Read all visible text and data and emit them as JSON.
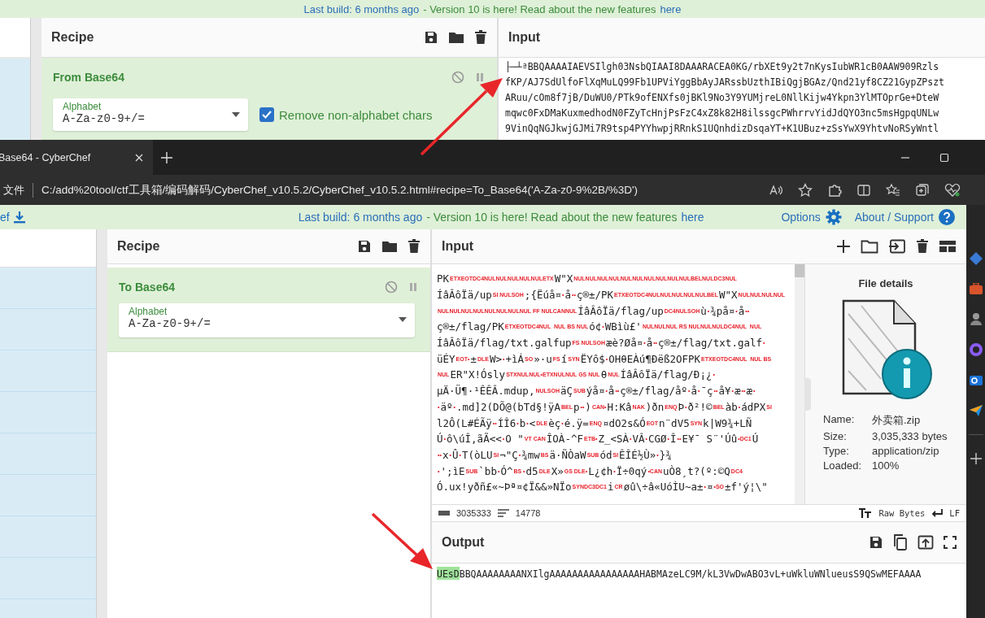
{
  "back_window": {
    "banner": {
      "build": "Last build: 6 months ago",
      "message": "- Version 10 is here! Read about the new features",
      "link": "here"
    },
    "recipe": {
      "title": "Recipe",
      "operation": {
        "name": "From Base64",
        "alphabet_label": "Alphabet",
        "alphabet": "A-Za-z0-9+/=",
        "checkbox": {
          "label": "Remove non-alphabet chars",
          "checked": true
        }
      }
    },
    "input": {
      "title": "Input",
      "lines": [
        "├─┴ªBBQAAAAIAEVSIlgh03NsbQIAAI8DAAARACEA0KG/rbXEt9y2t7nKysIubWR1cB0AAW909Rzls",
        "fKP/AJ7SdUlfoFlXqMuLQ99Fb1UPViYggBbAyJARssbUzthIBiQgjBGAz/Qnd21yf8CZ21GypZPszt",
        "ARuu/cOm8f7jB/DuWU0/PTk9ofENXfs0jBKl9No3Y9YUMjreL0NllKijw4Ykpn3YlMTOprGe+DteW",
        "mqwc0FxDMaKuxmedhodN0FZyTcHnjPsFzC4xZ8k82H8ilssgcPWhrrvYidJdQYO3nc5msHgpqUNLw",
        "9VinQqNGJkwjGJMi7R9tsp4PYYhwpjRRnkS1UQnhdizDsqaYT+K1UBuz+zSsYwX9YhtvNoRSyWntl"
      ]
    }
  },
  "browser": {
    "tab": {
      "title": "Base64 - CyberChef"
    },
    "address": {
      "scheme": "文件",
      "url": "C:/add%20tool/ctf工具箱/编码解码/CyberChef_v10.5.2/CyberChef_v10.5.2.html#recipe=To_Base64('A-Za-z0-9%2B/%3D')"
    }
  },
  "front_window": {
    "brand": "ef",
    "banner": {
      "build": "Last build: 6 months ago",
      "message": "- Version 10 is here! Read about the new features",
      "link": "here"
    },
    "options": "Options",
    "about": "About / Support",
    "recipe": {
      "title": "Recipe",
      "operation": {
        "name": "To Base64",
        "alphabet_label": "Alphabet",
        "alphabet": "A-Za-z0-9+/="
      }
    },
    "input": {
      "title": "Input",
      "lines": [
        [
          {
            "kind": "text",
            "text": "PK"
          },
          {
            "kind": "ctrl",
            "text": "ETXEOTDC4NULNULNULNULNULETX"
          },
          {
            "kind": "text",
            "text": "W\"X"
          },
          {
            "kind": "ctrl",
            "text": "NULNULNULNULNULNULNULNULNULNULBELNULDC3NUL"
          }
        ],
        [
          {
            "kind": "text",
            "text": "ÍâÂôÏä/up"
          },
          {
            "kind": "ctrl",
            "text": "SI NULSOH"
          },
          {
            "kind": "text",
            "text": ";{Ëúå¤"
          },
          {
            "kind": "ctrl",
            "text": "•"
          },
          {
            "kind": "text",
            "text": "å"
          },
          {
            "kind": "ctrl",
            "text": "••"
          },
          {
            "kind": "text",
            "text": "ç®±/PK"
          },
          {
            "kind": "ctrl",
            "text": "ETXEOTDC4NULNULNULNULNULBEL"
          },
          {
            "kind": "text",
            "text": "W\"X"
          },
          {
            "kind": "ctrl",
            "text": "NULNULNULNUL"
          }
        ],
        [
          {
            "kind": "ctrl",
            "text": "NULNULNULNULNULNULNULNUL FF NULCANNUL"
          },
          {
            "kind": "text",
            "text": "ÍâÂôÏä/flag/up"
          },
          {
            "kind": "ctrl",
            "text": "DC4NULSOH"
          },
          {
            "kind": "text",
            "text": "ù"
          },
          {
            "kind": "ctrl",
            "text": "•"
          },
          {
            "kind": "text",
            "text": "¾på¤"
          },
          {
            "kind": "ctrl",
            "text": "•"
          },
          {
            "kind": "text",
            "text": "å"
          },
          {
            "kind": "ctrl",
            "text": "••"
          }
        ],
        [
          {
            "kind": "text",
            "text": "ç®±/flag/PK"
          },
          {
            "kind": "ctrl",
            "text": "ETXEOTDC4NUL  NUL BS NUL"
          },
          {
            "kind": "text",
            "text": "ó¢"
          },
          {
            "kind": "ctrl",
            "text": "•"
          },
          {
            "kind": "text",
            "text": "WBìù£'"
          },
          {
            "kind": "ctrl",
            "text": "NULNULNUL RS NULNULNULDC4NUL  NUL"
          }
        ],
        [
          {
            "kind": "text",
            "text": "ÍâÂôÏä/flag/txt.galfup"
          },
          {
            "kind": "ctrl",
            "text": "FS NULSOH"
          },
          {
            "kind": "text",
            "text": "æè?Øå¤"
          },
          {
            "kind": "ctrl",
            "text": "•"
          },
          {
            "kind": "text",
            "text": "å"
          },
          {
            "kind": "ctrl",
            "text": "••"
          },
          {
            "kind": "text",
            "text": "ç®±/flag/txt.galf"
          },
          {
            "kind": "ctrl",
            "text": "•"
          }
        ],
        [
          {
            "kind": "text",
            "text": "üÉY"
          },
          {
            "kind": "ctrl",
            "text": "EOT•"
          },
          {
            "kind": "text",
            "text": "±"
          },
          {
            "kind": "ctrl",
            "text": "DLE"
          },
          {
            "kind": "text",
            "text": "W>"
          },
          {
            "kind": "ctrl",
            "text": "•"
          },
          {
            "kind": "text",
            "text": "+ìÁ"
          },
          {
            "kind": "ctrl",
            "text": "SO"
          },
          {
            "kind": "text",
            "text": "»·u"
          },
          {
            "kind": "ctrl",
            "text": "FS"
          },
          {
            "kind": "text",
            "text": "í"
          },
          {
            "kind": "ctrl",
            "text": "SYN"
          },
          {
            "kind": "text",
            "text": "ËYô$"
          },
          {
            "kind": "ctrl",
            "text": "•"
          },
          {
            "kind": "text",
            "text": "OHθEÀú¶Ðëß2OFPK"
          },
          {
            "kind": "ctrl",
            "text": "ETXEOTDC4NUL  NUL BS"
          }
        ],
        [
          {
            "kind": "ctrl",
            "text": "NUL"
          },
          {
            "kind": "text",
            "text": "ER\"X!Ósly"
          },
          {
            "kind": "ctrl",
            "text": "STXNULNUL•ETXNULNUL GS NUL"
          },
          {
            "kind": "text",
            "text": "θ"
          },
          {
            "kind": "ctrl",
            "text": "NUL"
          },
          {
            "kind": "text",
            "text": "ÍâÂôÏä/flag/Ð¡¿"
          },
          {
            "kind": "ctrl",
            "text": "•"
          }
        ],
        [
          {
            "kind": "text",
            "text": "µÄ·Ü¶·¹ÊÊÂ.mdup,"
          },
          {
            "kind": "ctrl",
            "text": "NULSOH"
          },
          {
            "kind": "text",
            "text": "äÇ"
          },
          {
            "kind": "ctrl",
            "text": "SUB"
          },
          {
            "kind": "text",
            "text": "ýå¤"
          },
          {
            "kind": "ctrl",
            "text": "•"
          },
          {
            "kind": "text",
            "text": "å"
          },
          {
            "kind": "ctrl",
            "text": "••"
          },
          {
            "kind": "text",
            "text": "ç®±/flag/åº"
          },
          {
            "kind": "ctrl",
            "text": "•"
          },
          {
            "kind": "text",
            "text": "å"
          },
          {
            "kind": "ctrl",
            "text": "•"
          },
          {
            "kind": "text",
            "text": "¯ç"
          },
          {
            "kind": "ctrl",
            "text": "••"
          },
          {
            "kind": "text",
            "text": "å¥"
          },
          {
            "kind": "ctrl",
            "text": "•"
          },
          {
            "kind": "text",
            "text": "æ"
          },
          {
            "kind": "ctrl",
            "text": "••"
          },
          {
            "kind": "text",
            "text": "æ"
          },
          {
            "kind": "ctrl",
            "text": "•"
          }
        ],
        [
          {
            "kind": "ctrl",
            "text": "•"
          },
          {
            "kind": "text",
            "text": "äº"
          },
          {
            "kind": "ctrl",
            "text": "•"
          },
          {
            "kind": "text",
            "text": ".md]2(DÕ@(bTd§!ÿA"
          },
          {
            "kind": "ctrl",
            "text": "BEL"
          },
          {
            "kind": "text",
            "text": "p"
          },
          {
            "kind": "ctrl",
            "text": "••"
          },
          {
            "kind": "text",
            "text": ")"
          },
          {
            "kind": "ctrl",
            "text": "CAN•"
          },
          {
            "kind": "text",
            "text": "H:Kâ"
          },
          {
            "kind": "ctrl",
            "text": "NAK"
          },
          {
            "kind": "text",
            "text": ")ðn"
          },
          {
            "kind": "ctrl",
            "text": "ENQ"
          },
          {
            "kind": "text",
            "text": "Þ"
          },
          {
            "kind": "ctrl",
            "text": "•"
          },
          {
            "kind": "text",
            "text": "ð²!©"
          },
          {
            "kind": "ctrl",
            "text": "BEL"
          },
          {
            "kind": "text",
            "text": "àb"
          },
          {
            "kind": "ctrl",
            "text": "•"
          },
          {
            "kind": "text",
            "text": "ádPX"
          },
          {
            "kind": "ctrl",
            "text": "SI"
          }
        ],
        [
          {
            "kind": "text",
            "text": "l2Ô(L#ÉÃÿ"
          },
          {
            "kind": "ctrl",
            "text": "••"
          },
          {
            "kind": "text",
            "text": "ÍÎ6"
          },
          {
            "kind": "ctrl",
            "text": "•"
          },
          {
            "kind": "text",
            "text": "b"
          },
          {
            "kind": "ctrl",
            "text": "•"
          },
          {
            "kind": "text",
            "text": "<"
          },
          {
            "kind": "ctrl",
            "text": "DLE"
          },
          {
            "kind": "text",
            "text": "èç"
          },
          {
            "kind": "ctrl",
            "text": "•"
          },
          {
            "kind": "text",
            "text": "é.ÿ="
          },
          {
            "kind": "ctrl",
            "text": "ENQ"
          },
          {
            "kind": "text",
            "text": "¤dO2s&Ó"
          },
          {
            "kind": "ctrl",
            "text": "EOT"
          },
          {
            "kind": "text",
            "text": "n¨dV5"
          },
          {
            "kind": "ctrl",
            "text": "SYN"
          },
          {
            "kind": "text",
            "text": "k|W9¾+LÑ"
          }
        ],
        [
          {
            "kind": "text",
            "text": "Ú"
          },
          {
            "kind": "ctrl",
            "text": "•"
          },
          {
            "kind": "text",
            "text": "ô\\úÎ,ãÃ<<"
          },
          {
            "kind": "ctrl",
            "text": "•"
          },
          {
            "kind": "text",
            "text": "O \""
          },
          {
            "kind": "ctrl",
            "text": "VT CAN"
          },
          {
            "kind": "text",
            "text": "ÎOÀ-^F"
          },
          {
            "kind": "ctrl",
            "text": "ETB•"
          },
          {
            "kind": "text",
            "text": "Z_<SÀ"
          },
          {
            "kind": "ctrl",
            "text": "•"
          },
          {
            "kind": "text",
            "text": "VÂ"
          },
          {
            "kind": "ctrl",
            "text": "•"
          },
          {
            "kind": "text",
            "text": "CGØ"
          },
          {
            "kind": "ctrl",
            "text": "•"
          },
          {
            "kind": "text",
            "text": "Î"
          },
          {
            "kind": "ctrl",
            "text": "••"
          },
          {
            "kind": "text",
            "text": "E¥¯ S¨'Úû"
          },
          {
            "kind": "ctrl",
            "text": "•DC1"
          },
          {
            "kind": "text",
            "text": "Ú"
          }
        ],
        [
          {
            "kind": "ctrl",
            "text": "••"
          },
          {
            "kind": "text",
            "text": "x"
          },
          {
            "kind": "ctrl",
            "text": "•"
          },
          {
            "kind": "text",
            "text": "Û"
          },
          {
            "kind": "ctrl",
            "text": "•"
          },
          {
            "kind": "text",
            "text": "T(òLU"
          },
          {
            "kind": "ctrl",
            "text": "SI"
          },
          {
            "kind": "text",
            "text": "¬\"Ç"
          },
          {
            "kind": "ctrl",
            "text": "•"
          },
          {
            "kind": "text",
            "text": "¾mw"
          },
          {
            "kind": "ctrl",
            "text": "BS"
          },
          {
            "kind": "text",
            "text": "ä·ÑÒaW"
          },
          {
            "kind": "ctrl",
            "text": "SUB"
          },
          {
            "kind": "text",
            "text": "ód"
          },
          {
            "kind": "ctrl",
            "text": "SI"
          },
          {
            "kind": "text",
            "text": "ÊÎÉ½Ù»"
          },
          {
            "kind": "ctrl",
            "text": "•"
          },
          {
            "kind": "text",
            "text": "}¾"
          }
        ],
        [
          {
            "kind": "ctrl",
            "text": "•"
          },
          {
            "kind": "text",
            "text": "';ìE"
          },
          {
            "kind": "ctrl",
            "text": "SUB"
          },
          {
            "kind": "text",
            "text": "`bb"
          },
          {
            "kind": "ctrl",
            "text": "•"
          },
          {
            "kind": "text",
            "text": "Ó^"
          },
          {
            "kind": "ctrl",
            "text": "BS •"
          },
          {
            "kind": "text",
            "text": "d5"
          },
          {
            "kind": "ctrl",
            "text": "DLE"
          },
          {
            "kind": "text",
            "text": "X»"
          },
          {
            "kind": "ctrl",
            "text": "GS DLE•"
          },
          {
            "kind": "text",
            "text": "L¿¢h"
          },
          {
            "kind": "ctrl",
            "text": "•"
          },
          {
            "kind": "text",
            "text": "Ï÷0qý"
          },
          {
            "kind": "ctrl",
            "text": "•CAN"
          },
          {
            "kind": "text",
            "text": "uÒ8¸t?(º:©Q"
          },
          {
            "kind": "ctrl",
            "text": "DC4"
          }
        ],
        [
          {
            "kind": "text",
            "text": "Ó.ux!yðñ£«~Þª¤¢Ï&&»NÏo"
          },
          {
            "kind": "ctrl",
            "text": "SYNDC3DC1"
          },
          {
            "kind": "text",
            "text": "i"
          },
          {
            "kind": "ctrl",
            "text": "CR"
          },
          {
            "kind": "text",
            "text": "øû\\÷â«UóÌU~a±"
          },
          {
            "kind": "ctrl",
            "text": "•"
          },
          {
            "kind": "text",
            "text": "¤"
          },
          {
            "kind": "ctrl",
            "text": "•SO"
          },
          {
            "kind": "text",
            "text": "±f'ý¦\\\""
          }
        ]
      ],
      "file_details": {
        "title": "File details",
        "rows": [
          {
            "label": "Name:",
            "value": "外卖箱.zip"
          },
          {
            "label": "Size:",
            "value": "3,035,333 bytes"
          },
          {
            "label": "Type:",
            "value": "application/zip"
          },
          {
            "label": "Loaded:",
            "value": "100%"
          }
        ]
      },
      "status": {
        "length": "3035333",
        "lines": "14778",
        "encoding": "Raw Bytes",
        "eol": "LF"
      }
    },
    "output": {
      "title": "Output",
      "highlight": "UEsD",
      "text": "BBQAAAAAAAANXIlgAAAAAAAAAAAAAAAAHABMAzeLC9M/kL3VwDwABO3vL+uWkluWNlueusS9QSwMEFAAAA"
    }
  }
}
